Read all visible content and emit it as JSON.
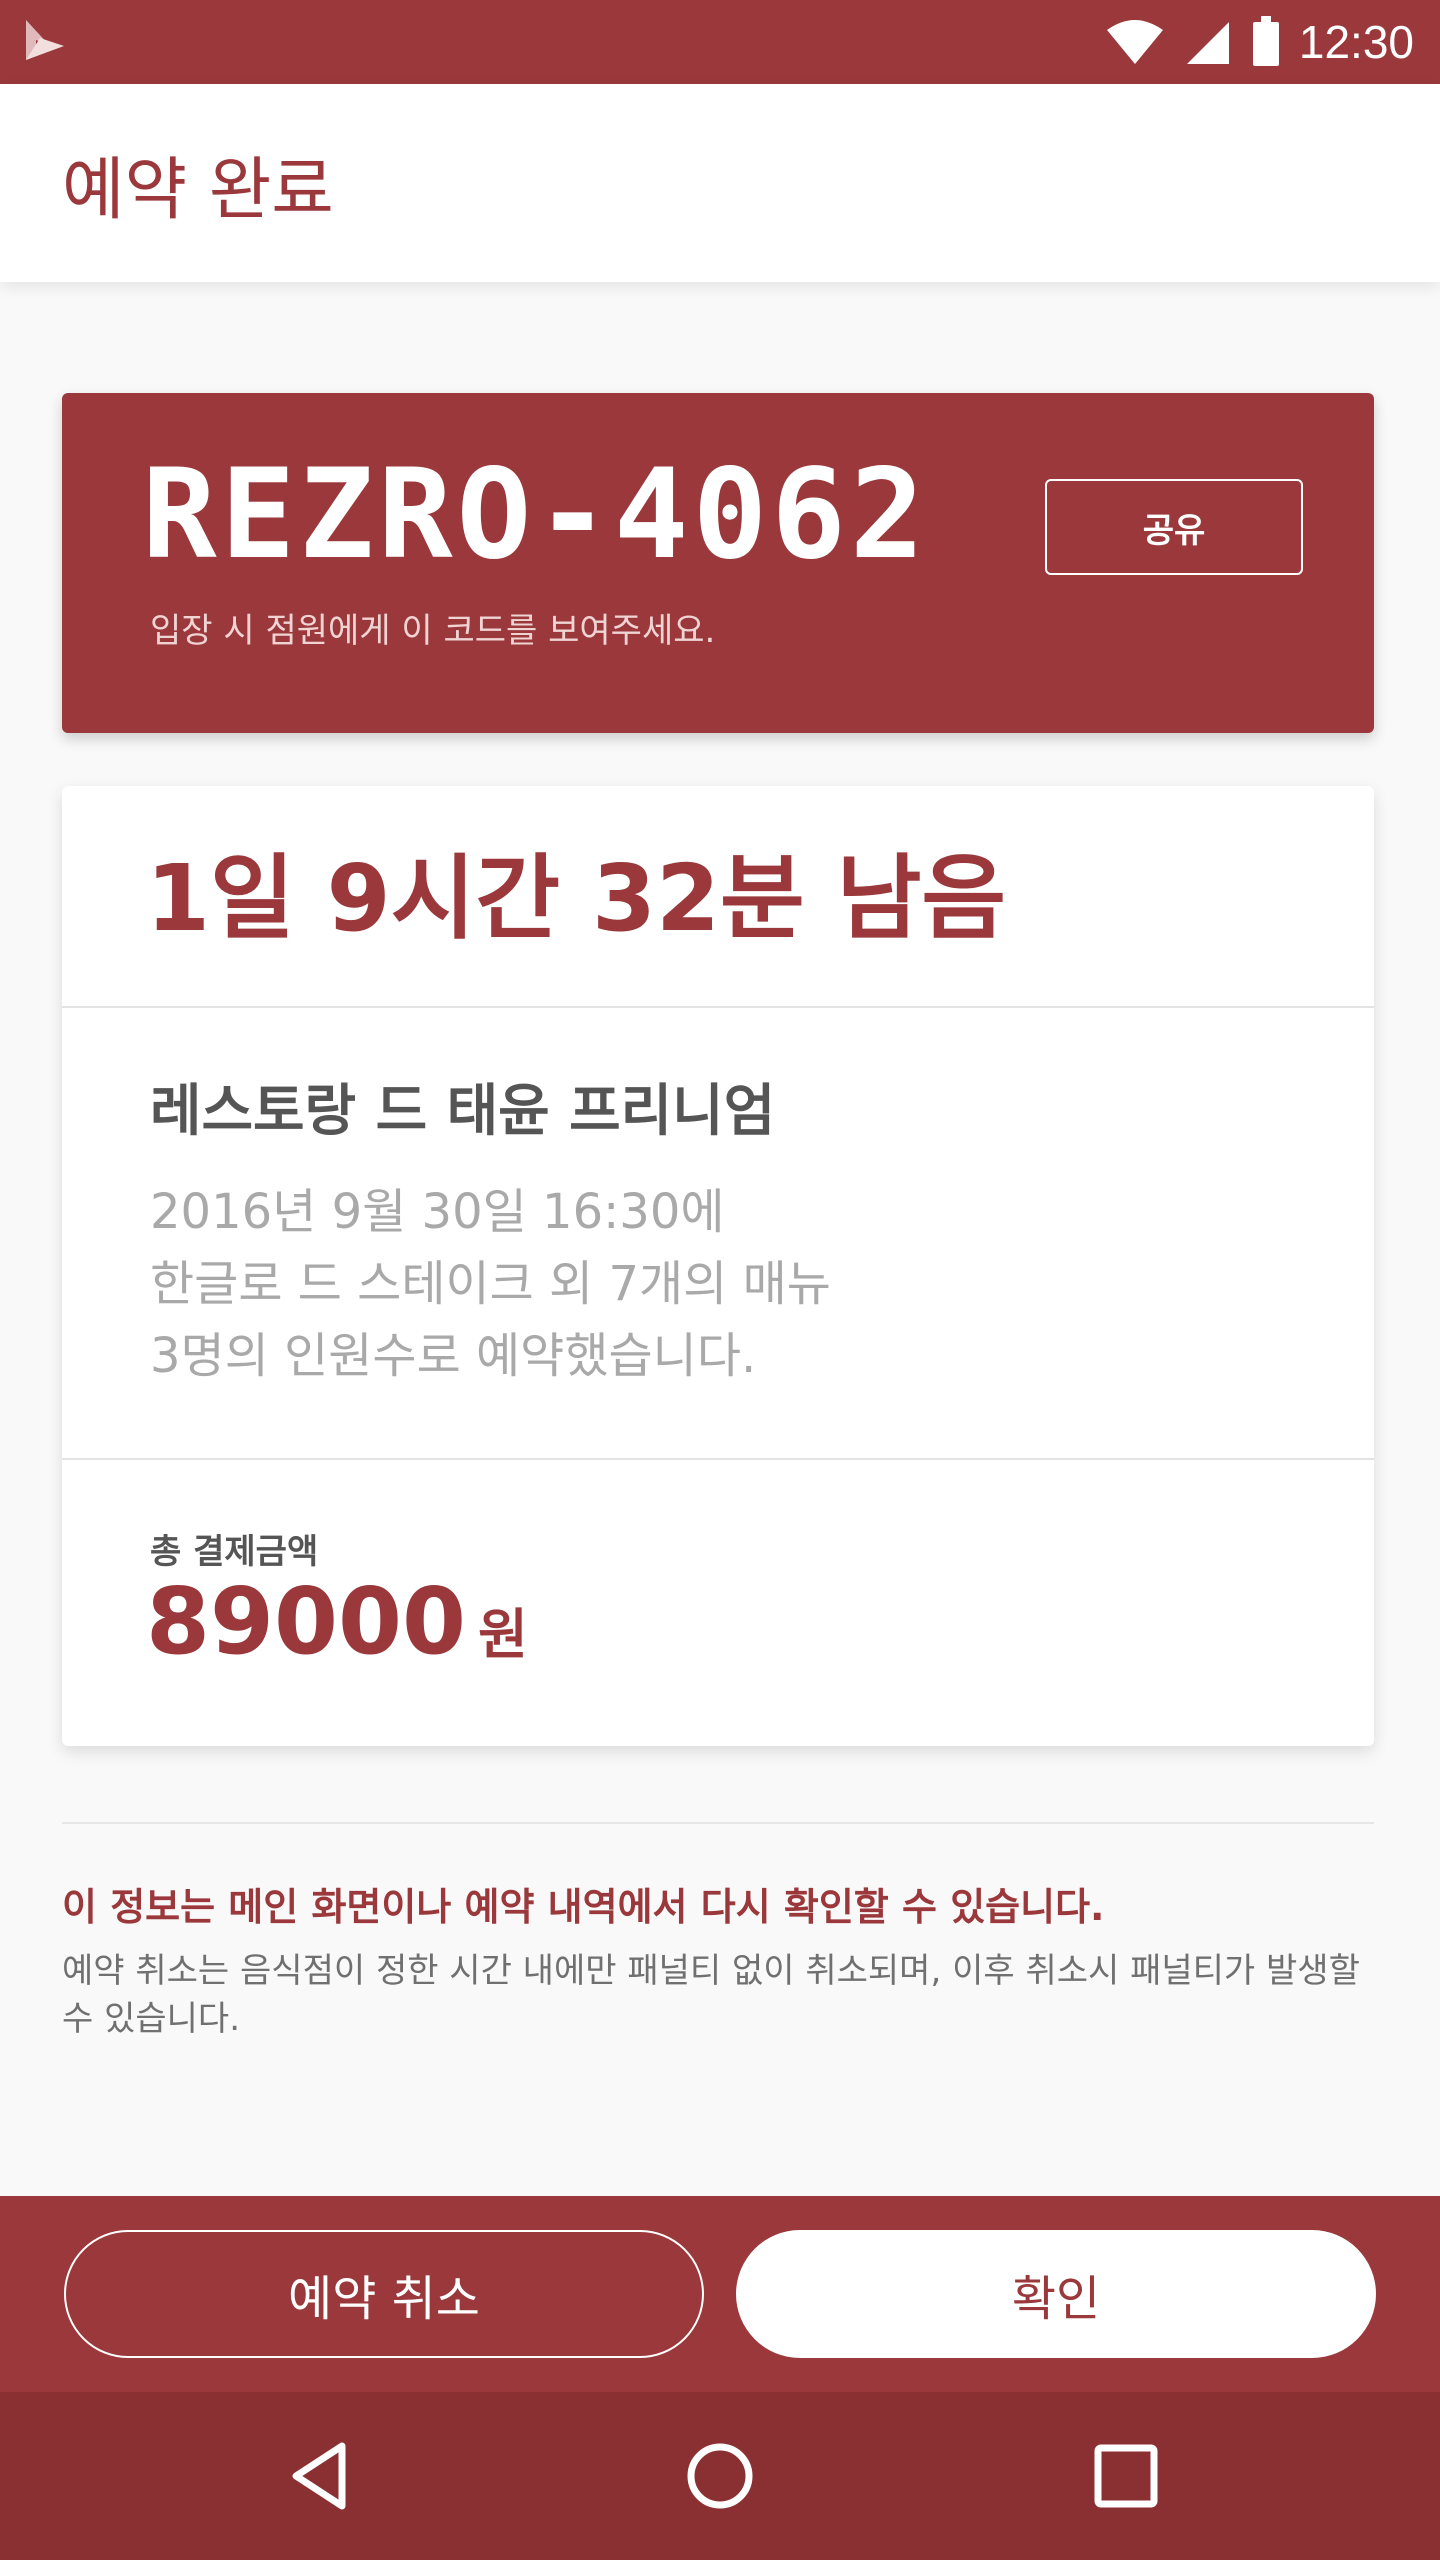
{
  "status_bar": {
    "time": "12:30",
    "icons": [
      "app-logo-icon",
      "wifi-icon",
      "signal-icon",
      "battery-icon"
    ]
  },
  "app_bar": {
    "title": "예약 완료"
  },
  "reservation": {
    "code": "REZRO-4062",
    "code_hint": "입장 시 점원에게 이 코드를 보여주세요.",
    "share_label": "공유"
  },
  "info": {
    "remaining": "1일 9시간 32분 남음",
    "restaurant_name": "레스토랑 드 태윤 프리니엄",
    "details": [
      "2016년 9월 30일 16:30에",
      "한글로 드 스테이크 외 7개의 매뉴",
      "3명의 인원수로 예약했습니다."
    ],
    "total_label": "총 결제금액",
    "total_amount": "89000",
    "total_unit": "원"
  },
  "notes": {
    "main": "이 정보는 메인 화면이나 예약 내역에서 다시 확인할 수 있습니다.",
    "sub": "예약 취소는 음식점이 정한 시간 내에만 패널티 없이 취소되며, 이후 취소시 패널티가 발생할 수 있습니다."
  },
  "actions": {
    "cancel_label": "예약 취소",
    "confirm_label": "확인"
  },
  "nav_bar": {
    "icons": [
      "back-icon",
      "home-icon",
      "recents-icon"
    ]
  },
  "colors": {
    "primary": "#9a383b",
    "nav_bar": "#8a3033",
    "background": "#f9f9f9"
  }
}
